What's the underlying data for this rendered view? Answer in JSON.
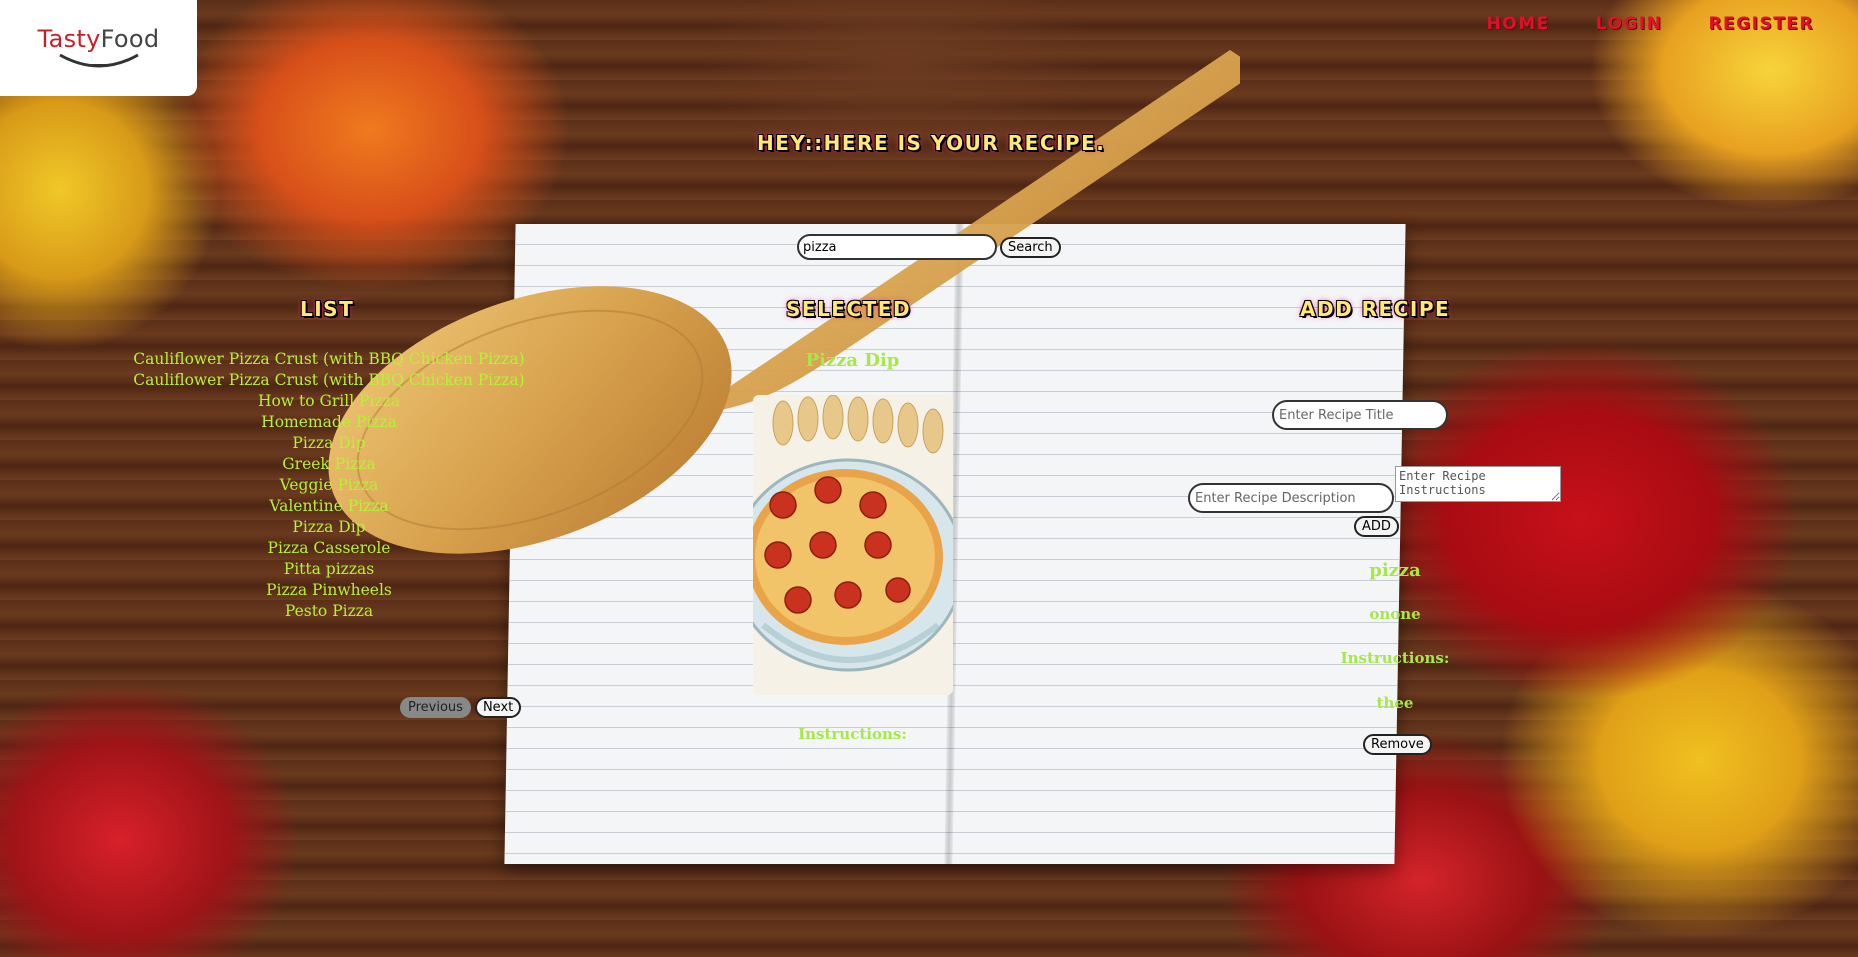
{
  "brand": {
    "name_part1": "Tasty",
    "name_part2": "Food"
  },
  "nav": {
    "home": "Home",
    "login": "Login",
    "register": "Register"
  },
  "hero": {
    "title": "Hey::Here is your recipe."
  },
  "search": {
    "value": "pizza",
    "button": "Search"
  },
  "columns": {
    "list": "List",
    "selected": "Selected",
    "add_recipe": "Add Recipe"
  },
  "recipes": [
    "Cauliflower Pizza Crust (with BBQ Chicken Pizza)",
    "Cauliflower Pizza Crust (with BBQ Chicken Pizza)",
    "How to Grill Pizza",
    "Homemade Pizza",
    "Pizza Dip",
    "Greek Pizza",
    "Veggie Pizza",
    "Valentine Pizza",
    "Pizza Dip",
    "Pizza Casserole",
    "Pitta pizzas",
    "Pizza Pinwheels",
    "Pesto Pizza"
  ],
  "pager": {
    "previous": "Previous",
    "next": "Next"
  },
  "selected": {
    "name": "Pizza Dip",
    "instructions_label": "Instructions:",
    "image_icon": "pizza-dip-photo"
  },
  "add_form": {
    "title_placeholder": "Enter Recipe Title",
    "description_placeholder": "Enter Recipe Description",
    "instructions_placeholder": "Enter Recipe Instructions",
    "add_button": "ADD"
  },
  "added_recipe": {
    "title": "pizza",
    "description": "onone",
    "instructions_label": "Instructions:",
    "instructions": "thee",
    "remove_button": "Remove"
  },
  "colors": {
    "accent_green": "#a6e84a",
    "nav_red": "#e0102a",
    "title_yellow": "#ffe77a"
  }
}
